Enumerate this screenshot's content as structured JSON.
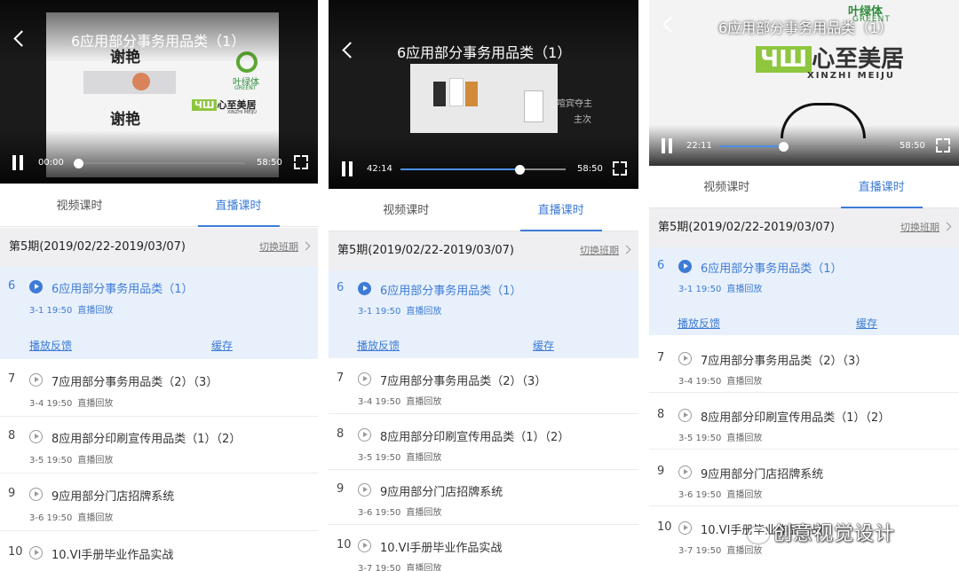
{
  "video": {
    "title": "6应用部分事务用品类（1）",
    "duration": "58:50",
    "accent_color": "#4a8fe7"
  },
  "tabs": [
    {
      "label": "视频课时",
      "active": false
    },
    {
      "label": "直播课时",
      "active": true
    }
  ],
  "period": {
    "label": "第5期(2019/02/22-2019/03/07)",
    "switch_label": "切换班期"
  },
  "active_actions": {
    "feedback": "播放反馈",
    "cache": "缓存"
  },
  "lessons": [
    {
      "num": "6",
      "title": "6应用部分事务用品类（1）",
      "date": "3-1 19:50",
      "type": "直播回放"
    },
    {
      "num": "7",
      "title": "7应用部分事务用品类（2）（3）",
      "date": "3-4 19:50",
      "type": "直播回放"
    },
    {
      "num": "8",
      "title": "8应用部分印刷宣传用品类（1）（2）",
      "date": "3-5 19:50",
      "type": "直播回放"
    },
    {
      "num": "9",
      "title": "9应用部分门店招牌系统",
      "date": "3-6 19:50",
      "type": "直播回放"
    },
    {
      "num": "10",
      "title": "10.VI手册毕业作品实战",
      "date": "3-7 19:50",
      "type": "直播回放"
    }
  ],
  "panels": [
    {
      "time": "00:00",
      "progress": 0.0
    },
    {
      "time": "42:14",
      "progress": 0.72
    },
    {
      "time": "22:11",
      "progress": 0.38
    }
  ],
  "slide_text": {
    "p1_logo_a": "谢艳",
    "p1_logo_b": "叶绿体",
    "p1_logo_b_en": "GREENT",
    "p1_logo_c": "心至美居",
    "p1_logo_c_en": "XINZHI MEIJU",
    "p2_note_a": "喧宾夺主",
    "p2_note_b": "主次",
    "p3_logo": "心至美居",
    "p3_logo_en": "XINZHI MEIJU",
    "p3_top": "叶绿体",
    "p3_top_en": "GREENT"
  },
  "watermark": "创意视觉设计"
}
